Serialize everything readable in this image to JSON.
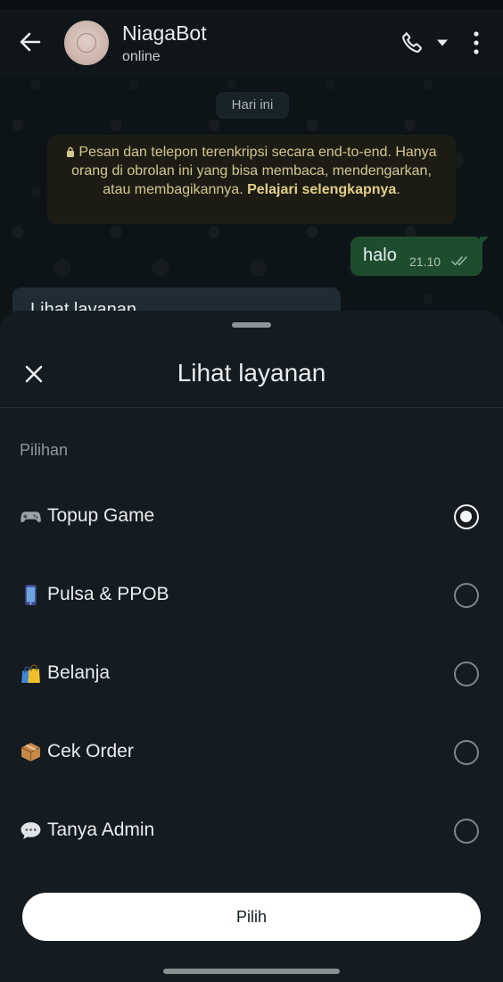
{
  "header": {
    "contact_name": "NiagaBot",
    "status": "online",
    "icons": [
      "back-arrow-icon",
      "avatar",
      "phone-icon",
      "chevron-down-icon",
      "more-vert-icon"
    ]
  },
  "chat": {
    "date_chip": "Hari ini",
    "encryption_notice": {
      "text": "Pesan dan telepon terenkripsi secara end-to-end. Hanya orang di obrolan ini yang bisa membaca, mendengarkan, atau membagikannya.",
      "link": "Pelajari selengkapnya",
      "suffix": "."
    },
    "outgoing": {
      "text": "halo",
      "time": "21.10",
      "status": "read"
    },
    "incoming_preview": "Lihat layanan"
  },
  "sheet": {
    "title": "Lihat layanan",
    "section_label": "Pilihan",
    "options": [
      {
        "emoji": "video-game-emoji",
        "label": "Topup Game",
        "selected": true
      },
      {
        "emoji": "mobile-phone-emoji",
        "label": "Pulsa & PPOB",
        "selected": false
      },
      {
        "emoji": "shopping-bags-emoji",
        "label": "Belanja",
        "selected": false
      },
      {
        "emoji": "package-emoji",
        "label": "Cek Order",
        "selected": false
      },
      {
        "emoji": "speech-balloon-emoji",
        "label": "Tanya Admin",
        "selected": false
      }
    ],
    "submit_label": "Pilih"
  },
  "colors": {
    "chat_background": "#0d1418",
    "outgoing_bubble": "#1e4d2e",
    "encryption_text": "#d3c68d",
    "sheet_background": "#141b21",
    "button_background": "#ffffff"
  }
}
